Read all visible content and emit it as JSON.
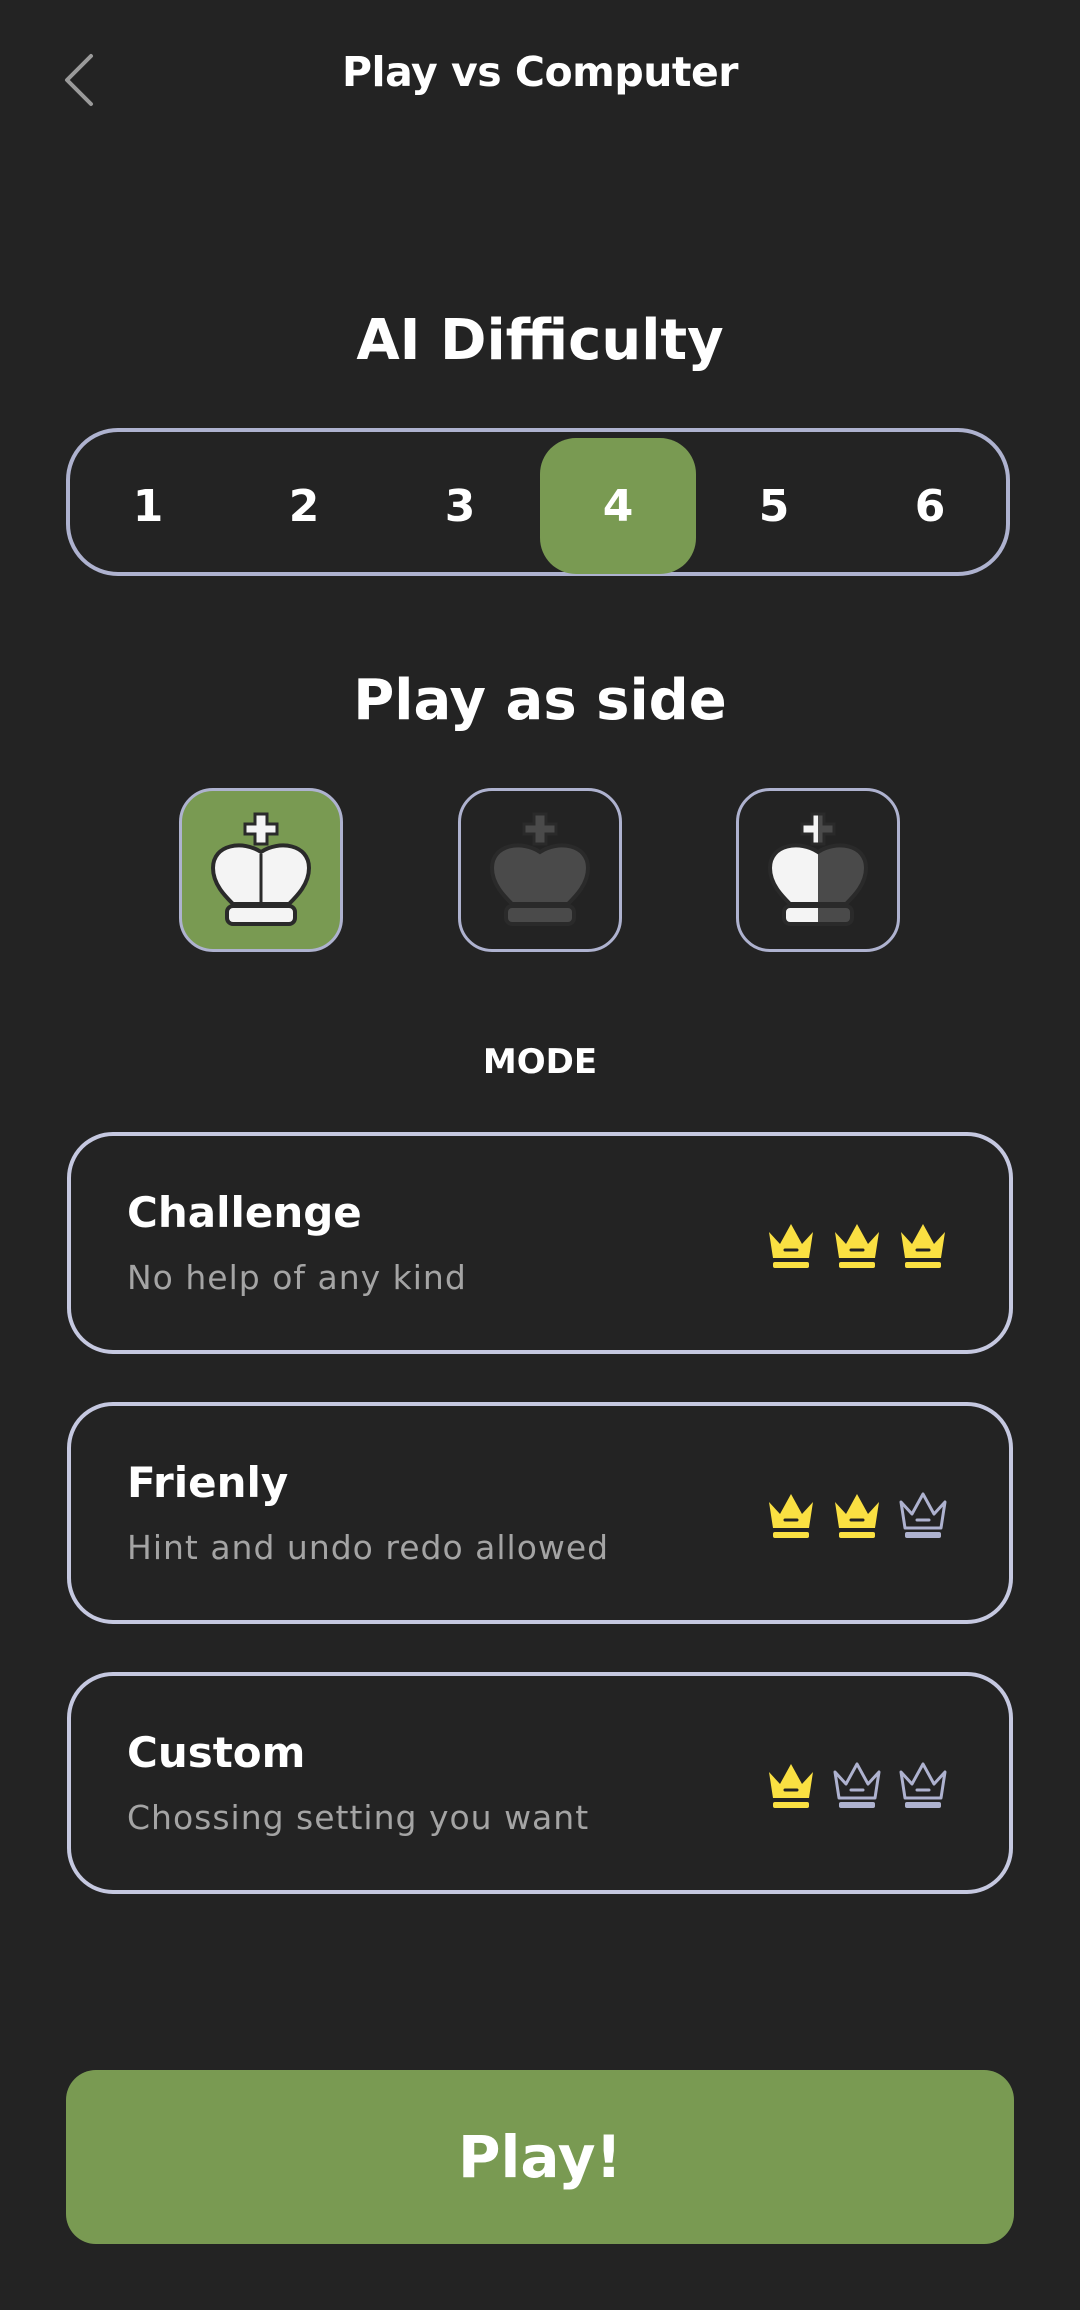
{
  "header": {
    "title": "Play vs Computer",
    "back_icon": "chevron-left-icon"
  },
  "difficulty": {
    "title": "AI Difficulty",
    "levels": [
      "1",
      "2",
      "3",
      "4",
      "5",
      "6"
    ],
    "selected": "4"
  },
  "side": {
    "title": "Play as side",
    "options": [
      {
        "name": "white",
        "icon": "white-king-icon",
        "selected": true
      },
      {
        "name": "black",
        "icon": "black-king-icon",
        "selected": false
      },
      {
        "name": "random",
        "icon": "half-white-half-black-king-icon",
        "selected": false
      }
    ]
  },
  "mode": {
    "title": "MODE",
    "options": [
      {
        "name": "Challenge",
        "description": "No help of any kind",
        "rating": 3,
        "rating_max": 3
      },
      {
        "name": "Frienly",
        "description": "Hint and undo redo allowed",
        "rating": 2,
        "rating_max": 3
      },
      {
        "name": "Custom",
        "description": "Chossing setting you want",
        "rating": 1,
        "rating_max": 3
      }
    ]
  },
  "play_button": {
    "label": "Play!"
  },
  "colors": {
    "background": "#232323",
    "accent_green": "#799a52",
    "border": "#aeb2cf",
    "crown_filled": "#fae042",
    "crown_empty": "#aeb2cf",
    "muted_text": "#a4a4a4"
  }
}
